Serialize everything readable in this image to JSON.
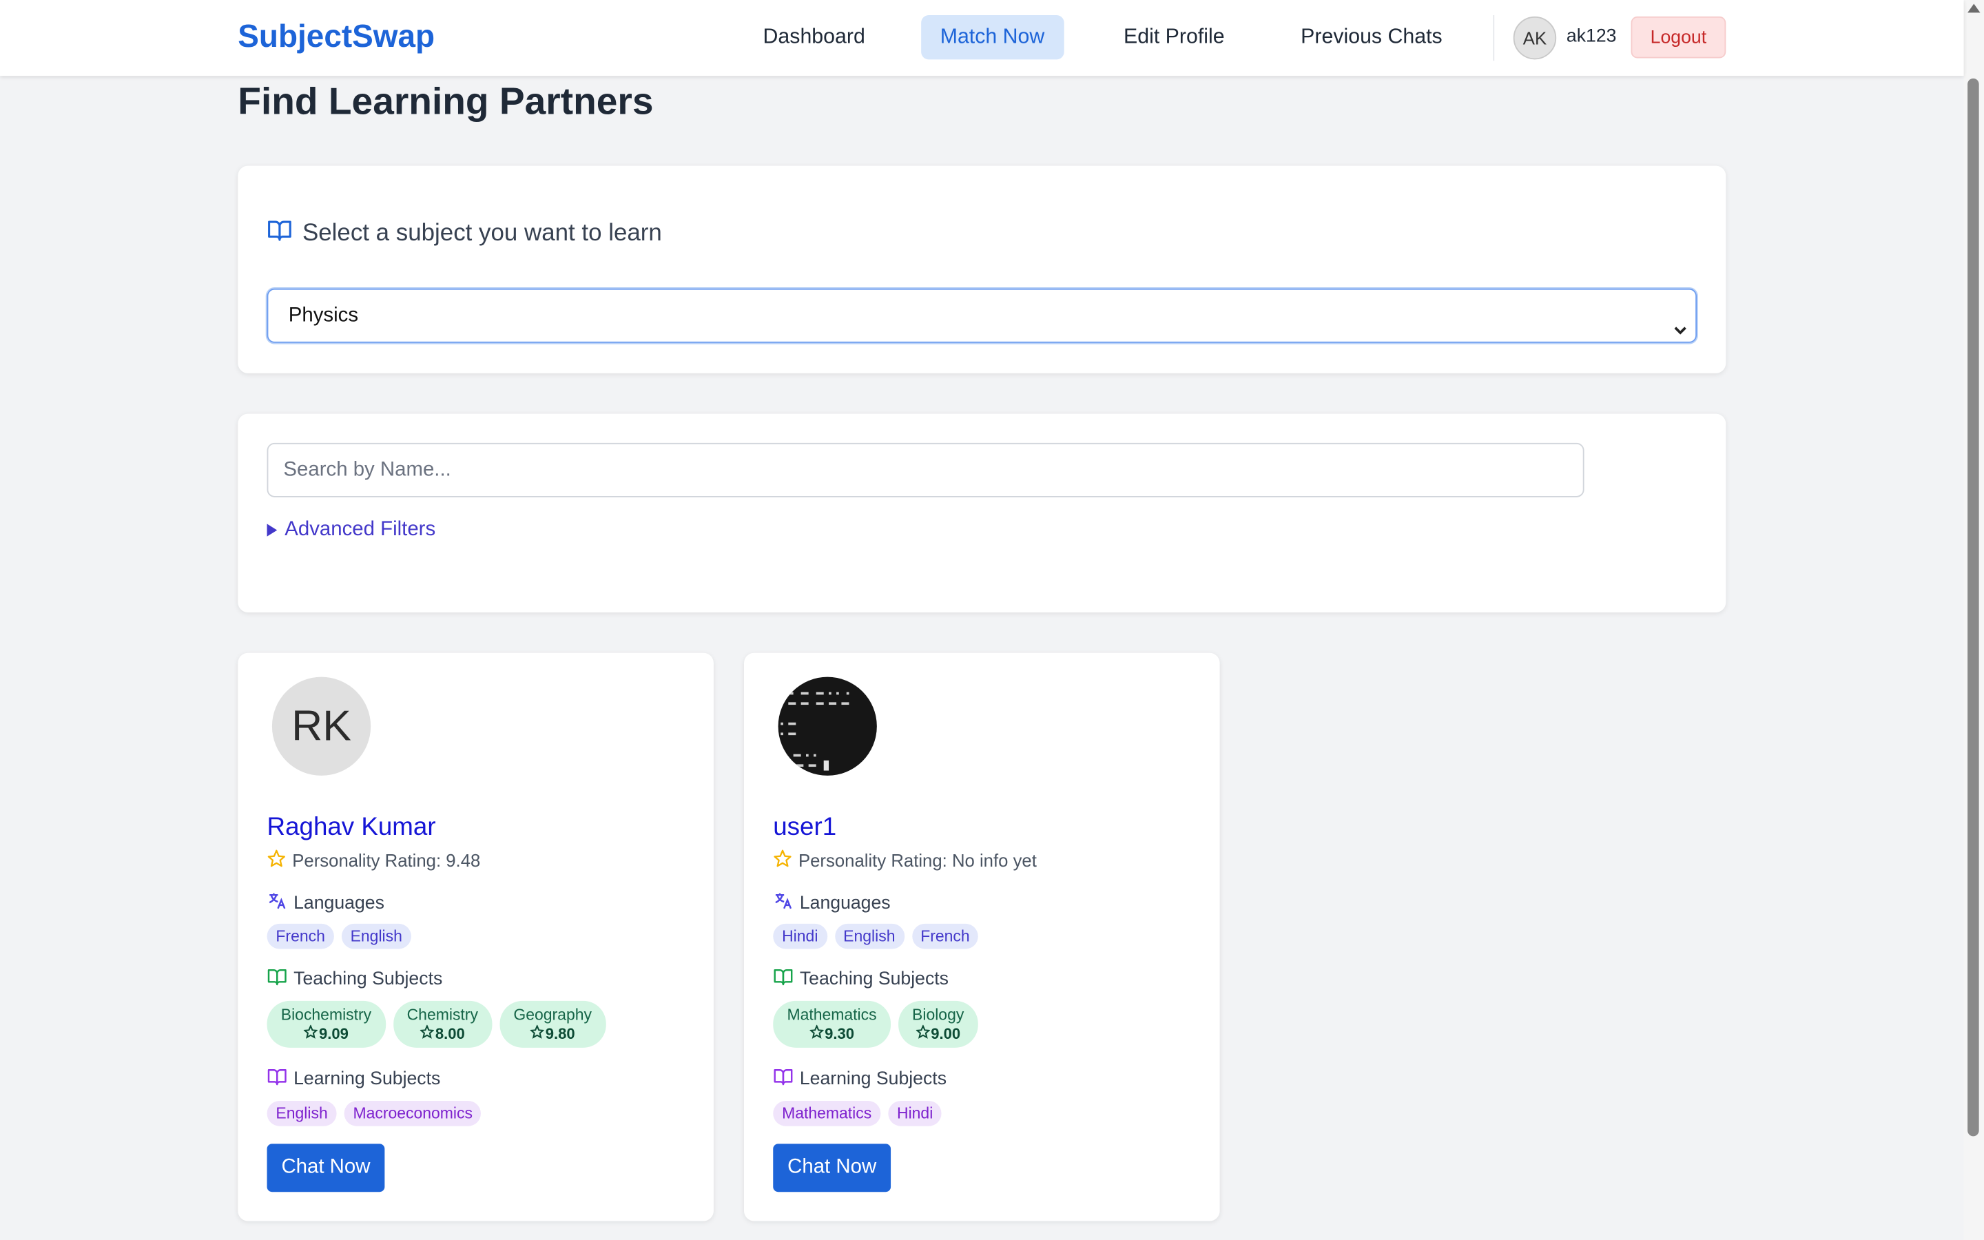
{
  "header": {
    "brand": "SubjectSwap",
    "nav": [
      "Dashboard",
      "Match Now",
      "Edit Profile",
      "Previous Chats"
    ],
    "active_nav": "Match Now",
    "user_initials": "AK",
    "username": "ak123",
    "logout_label": "Logout"
  },
  "page": {
    "title": "Find Learning Partners"
  },
  "subject_select": {
    "heading": "Select a subject you want to learn",
    "value": "Physics"
  },
  "filters": {
    "search_placeholder": "Search by Name...",
    "advanced_label": "Advanced Filters"
  },
  "users": [
    {
      "initials": "RK",
      "name": "Raghav Kumar",
      "rating_text": "Personality Rating: 9.48",
      "languages_title": "Languages",
      "languages": [
        "French",
        "English"
      ],
      "teaching_title": "Teaching Subjects",
      "teaching": [
        {
          "subject": "Biochemistry",
          "score": "9.09"
        },
        {
          "subject": "Chemistry",
          "score": "8.00"
        },
        {
          "subject": "Geography",
          "score": "9.80"
        }
      ],
      "learning_title": "Learning Subjects",
      "learning": [
        "English",
        "Macroeconomics"
      ],
      "chat_label": "Chat Now"
    },
    {
      "initials": "",
      "name": "user1",
      "rating_text": "Personality Rating: No info yet",
      "languages_title": "Languages",
      "languages": [
        "Hindi",
        "English",
        "French"
      ],
      "teaching_title": "Teaching Subjects",
      "teaching": [
        {
          "subject": "Mathematics",
          "score": "9.30"
        },
        {
          "subject": "Biology",
          "score": "9.00"
        }
      ],
      "learning_title": "Learning Subjects",
      "learning": [
        "Mathematics",
        "Hindi"
      ],
      "chat_label": "Chat Now"
    }
  ],
  "colors": {
    "brand": "#1d64d8",
    "active_nav_bg": "#d6e6fb",
    "logout_bg": "#fde2e2",
    "teaching_chip_bg": "#d4f5e3",
    "language_chip_bg": "#e3e8fb",
    "learning_chip_bg": "#f0e4fb"
  }
}
